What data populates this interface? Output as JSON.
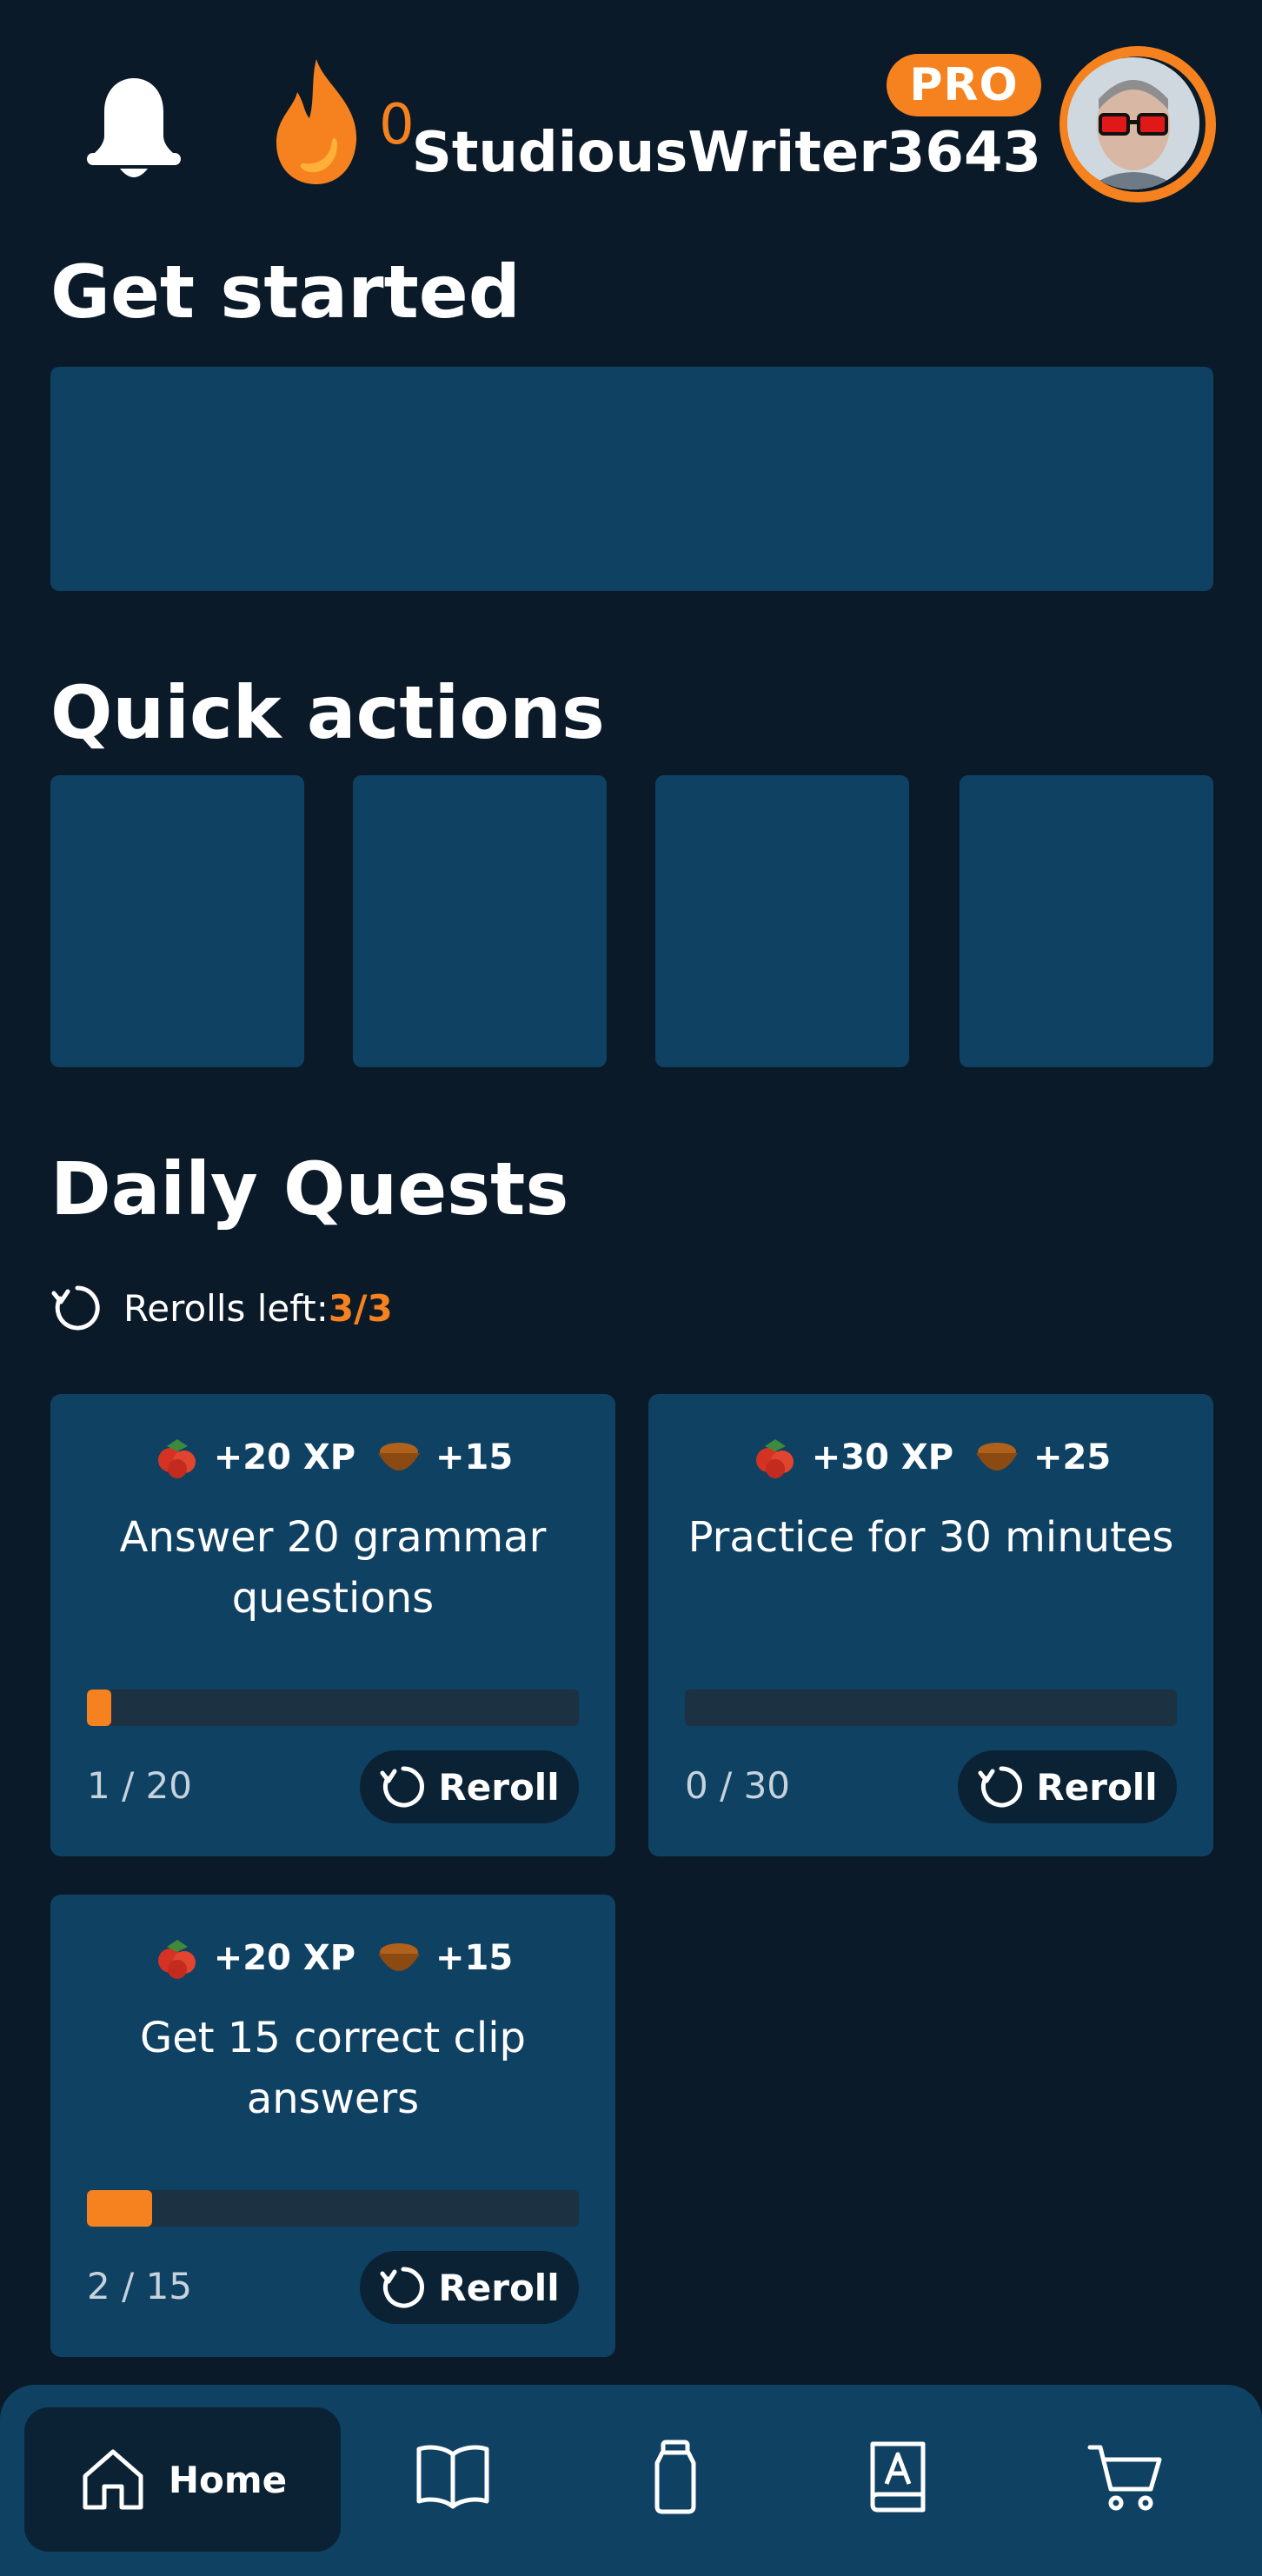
{
  "header": {
    "streak_count": "0",
    "pro_badge": "PRO",
    "username": "StudiousWriter3643"
  },
  "sections": {
    "get_started": "Get started",
    "quick_actions": "Quick actions",
    "daily_quests": "Daily Quests"
  },
  "rerolls": {
    "label": "Rerolls left: ",
    "value": "3/3"
  },
  "quests": [
    {
      "xp": "+20 XP",
      "nuts": "+15",
      "title": "Answer 20 grammar questions",
      "progress_text": "1 / 20",
      "progress": 0.05,
      "reroll_label": "Reroll"
    },
    {
      "xp": "+30 XP",
      "nuts": "+25",
      "title": "Practice for 30 minutes",
      "progress_text": "0 / 30",
      "progress": 0,
      "reroll_label": "Reroll"
    },
    {
      "xp": "+20 XP",
      "nuts": "+15",
      "title": "Get 15 correct clip answers",
      "progress_text": "2 / 15",
      "progress": 0.133,
      "reroll_label": "Reroll"
    }
  ],
  "nav": {
    "home_label": "Home",
    "items": [
      "home-icon",
      "book-icon",
      "jar-icon",
      "dictionary-icon",
      "cart-icon"
    ]
  },
  "colors": {
    "background": "#0a1a28",
    "panel": "#0f4163",
    "accent": "#f5821f",
    "button_dark": "#0a2234"
  }
}
